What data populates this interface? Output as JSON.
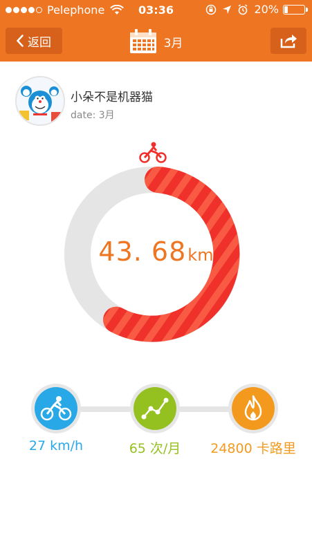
{
  "status": {
    "carrier": "Pelephone",
    "time": "03:36",
    "battery": "20%",
    "battery_level": 0.2
  },
  "nav": {
    "back_label": "返回",
    "title": "3月"
  },
  "profile": {
    "name": "小朵不是机器猫",
    "date": "date: 3月"
  },
  "distance": {
    "value": "43. 68",
    "unit": "km"
  },
  "ring": {
    "progress": 0.58
  },
  "stats": [
    {
      "label": "27 km/h",
      "color": "#29a8e8",
      "icon": "bicycle-icon"
    },
    {
      "label": "65 次/月",
      "color": "#94c11f",
      "icon": "trend-icon"
    },
    {
      "label": "24800 卡路里",
      "color": "#f39a1e",
      "icon": "flame-icon"
    }
  ],
  "colors": {
    "brand": "#ee7522",
    "ring": "#f0302a",
    "ring_track": "#e5e5e5"
  }
}
